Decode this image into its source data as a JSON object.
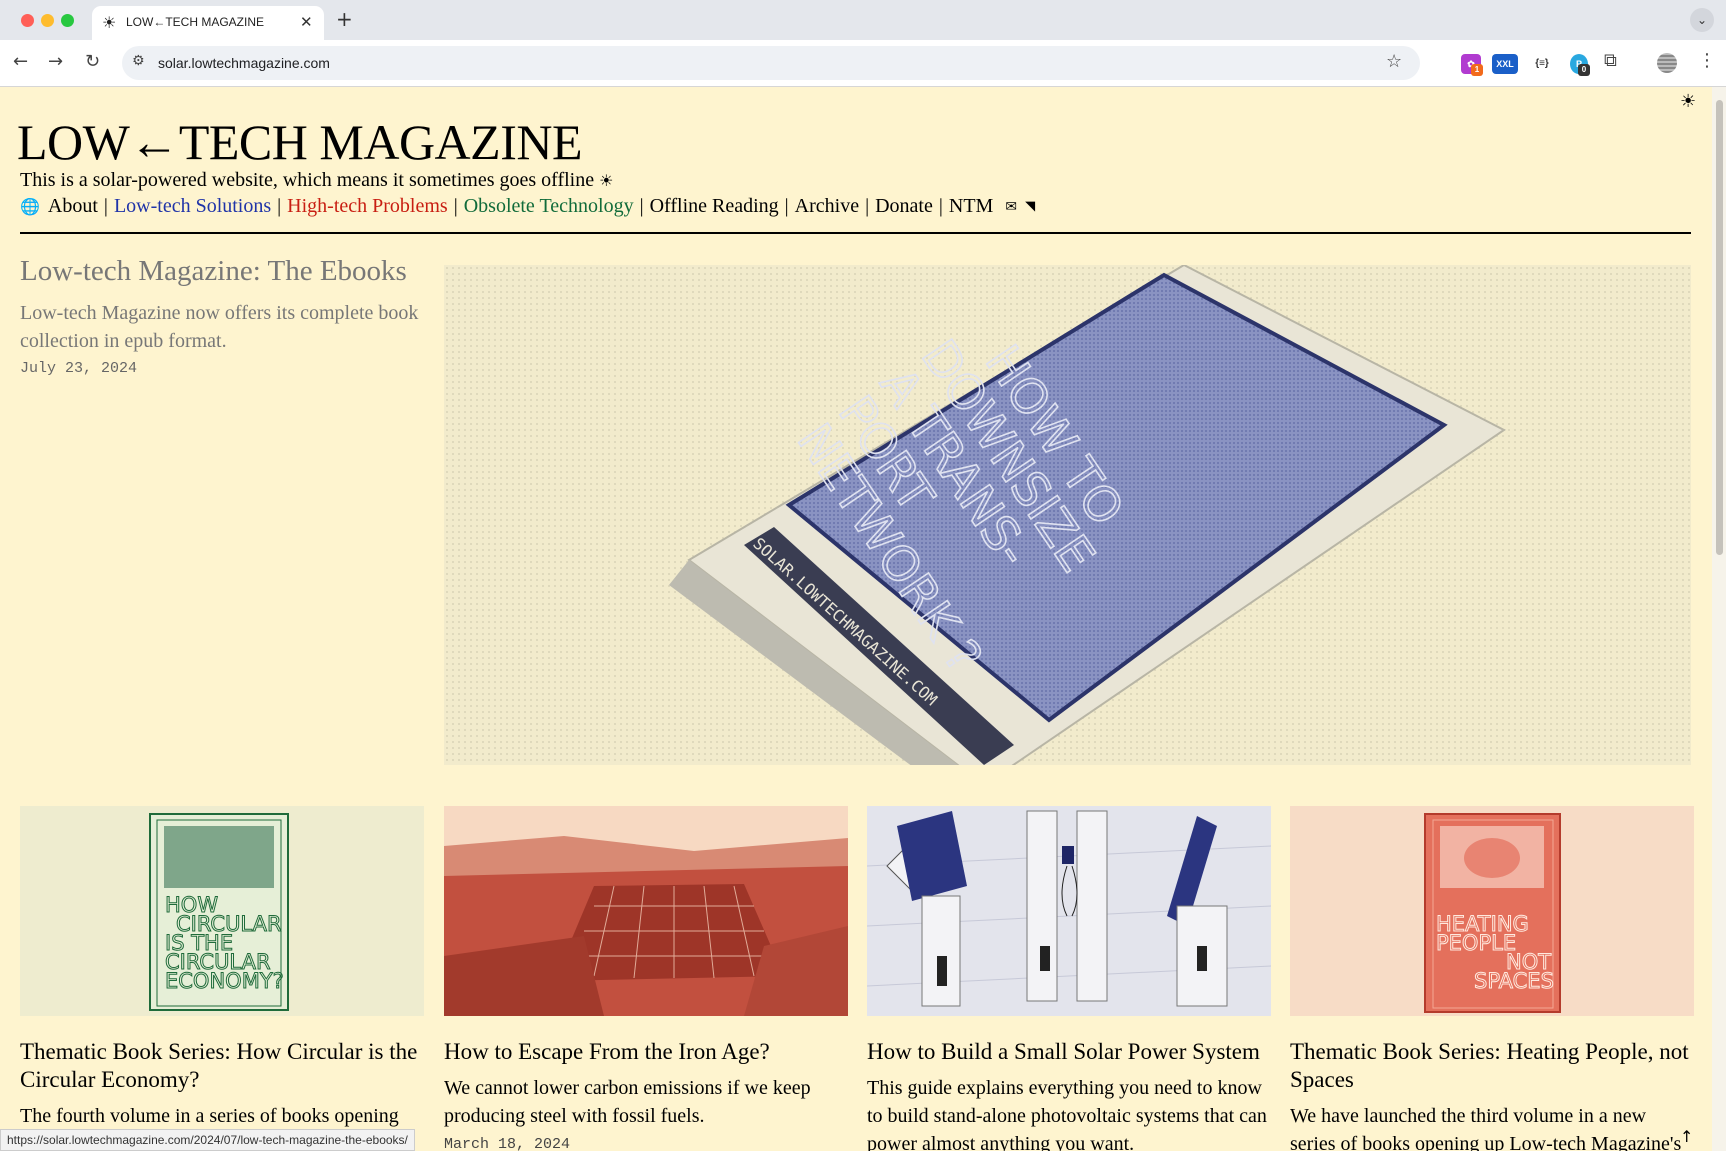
{
  "browser": {
    "tab_title": "LOW←TECH MAGAZINE",
    "tab_icon": "sun-icon",
    "url": "solar.lowtechmagazine.com",
    "extensions": [
      {
        "name": "extension-purple",
        "badge": "1"
      },
      {
        "name": "extension-xxl",
        "label": "XXL"
      },
      {
        "name": "extension-json",
        "label": "{≡}"
      },
      {
        "name": "extension-blue",
        "label": "P",
        "badge": "0"
      }
    ],
    "status_url": "https://solar.lowtechmagazine.com/2024/07/low-tech-magazine-the-ebooks/"
  },
  "site": {
    "masthead": "LOW←TECH MAGAZINE",
    "tagline": "This is a solar-powered website, which means it sometimes goes offline",
    "tagline_icon": "☀",
    "menu": [
      {
        "label": "About",
        "color": "#000000"
      },
      {
        "label": "Low-tech Solutions",
        "color": "#1f33a8"
      },
      {
        "label": "High-tech Problems",
        "color": "#c81e12"
      },
      {
        "label": "Obsolete Technology",
        "color": "#116b3a"
      },
      {
        "label": "Offline Reading",
        "color": "#000000"
      },
      {
        "label": "Archive",
        "color": "#000000"
      },
      {
        "label": "Donate",
        "color": "#000000"
      },
      {
        "label": "NTM",
        "color": "#000000"
      }
    ]
  },
  "hero": {
    "title": "Low-tech Magazine: The Ebooks",
    "summary": "Low-tech Magazine now offers its complete book collection in epub format.",
    "date": "July 23, 2024",
    "image_text": [
      "HOW TO",
      "DOWNSIZE",
      "A TRANS-",
      "PORT",
      "NETWORK ?"
    ],
    "image_side_text": "SOLAR.LOWTECHMAGAZINE.COM"
  },
  "cards": [
    {
      "title": "Thematic Book Series: How Circular is the Circular Economy?",
      "summary": "The fourth volume in a series of books opening",
      "date": "",
      "cover_text": [
        "HOW",
        "CIRCULAR",
        "IS THE",
        "CIRCULAR",
        "ECONOMY?"
      ]
    },
    {
      "title": "How to Escape From the Iron Age?",
      "summary": "We cannot lower carbon emissions if we keep producing steel with fossil fuels.",
      "date": "March 18, 2024"
    },
    {
      "title": "How to Build a Small Solar Power System",
      "summary": "This guide explains everything you need to know to build stand-alone photovoltaic systems that can power almost anything you want.",
      "date": ""
    },
    {
      "title": "Thematic Book Series: Heating People, not Spaces",
      "summary": "We have launched the third volume in a new series of books opening up Low-tech Magazine's",
      "date": "",
      "cover_text": [
        "HEATING",
        "PEOPLE",
        "NOT",
        "SPACES"
      ]
    }
  ]
}
